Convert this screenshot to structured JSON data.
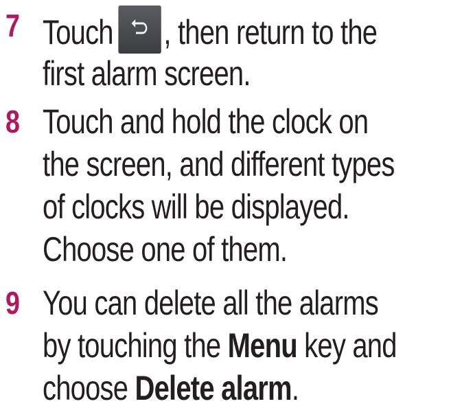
{
  "steps": [
    {
      "number": "7",
      "line1_a": "Touch",
      "icon": "back-arrow-icon",
      "line1_b": ", then return to the",
      "line2": "first alarm screen."
    },
    {
      "number": "8",
      "line1": "Touch and hold the clock on",
      "line2": "the screen, and different types",
      "line3": "of clocks will be displayed.",
      "line4": "Choose one of them."
    },
    {
      "number": "9",
      "line1": "You can delete all the alarms",
      "line2_a": "by touching the ",
      "line2_bold": "Menu",
      "line2_b": " key and",
      "line3_a": "choose ",
      "line3_bold": "Delete alarm",
      "line3_b": "."
    }
  ],
  "colors": {
    "step_number": "#b0185f",
    "text": "#231f20",
    "icon_button": "#4a4c50"
  }
}
